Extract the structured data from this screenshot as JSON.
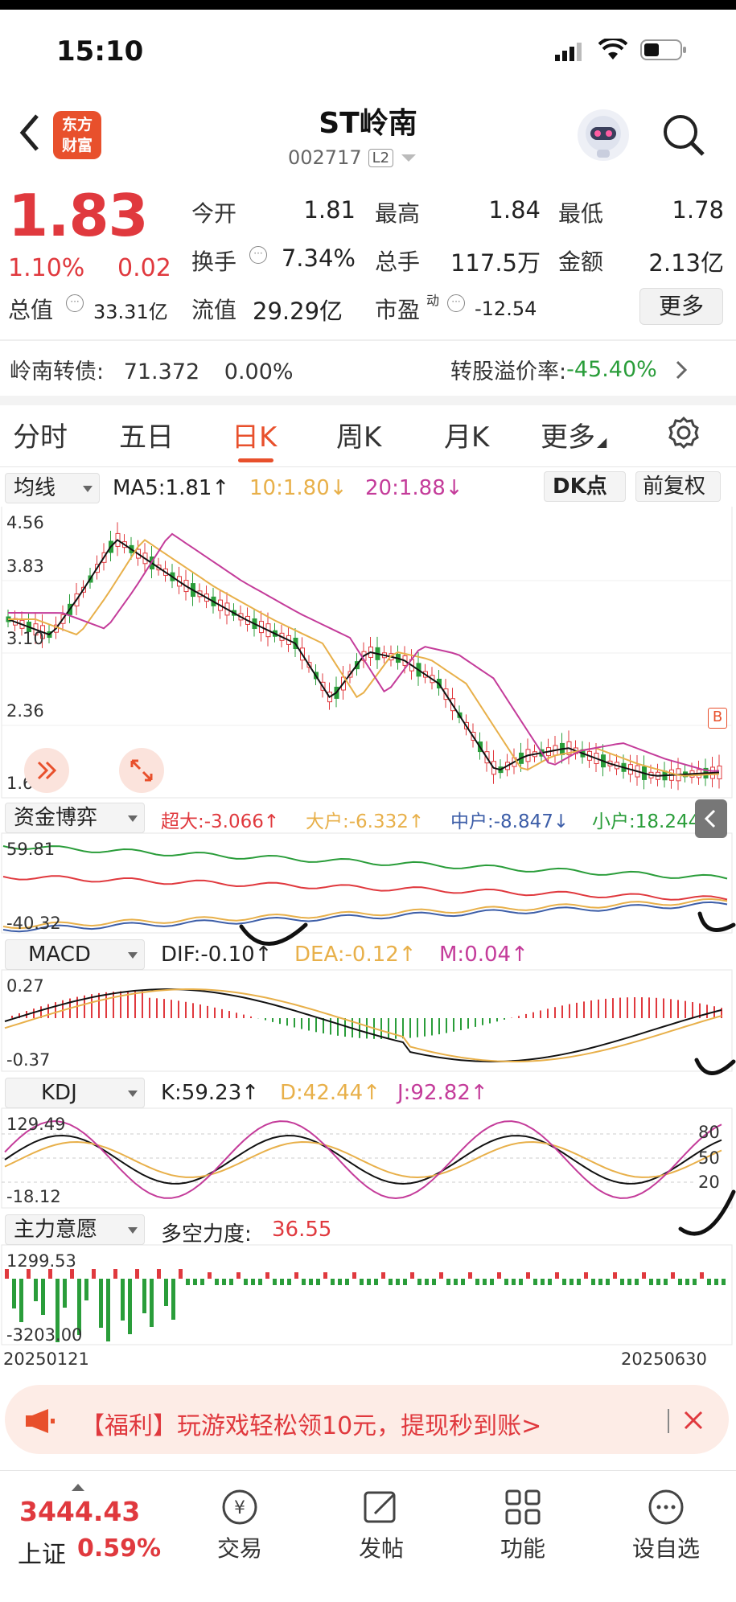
{
  "status": {
    "time": "15:10"
  },
  "header": {
    "back_label": "<",
    "logo_line1": "东方",
    "logo_line2": "财富",
    "title": "ST岭南",
    "code": "002717",
    "level_badge": "L2"
  },
  "quote": {
    "price": "1.83",
    "change_pct": "1.10%",
    "change_amt": "0.02",
    "open_label": "今开",
    "open": "1.81",
    "high_label": "最高",
    "high": "1.84",
    "low_label": "最低",
    "low": "1.78",
    "turnover_label": "换手",
    "turnover": "7.34%",
    "volume_label": "总手",
    "volume": "117.5万",
    "amount_label": "金额",
    "amount": "2.13亿",
    "mktcap_label": "总值",
    "mktcap": "33.31亿",
    "float_label": "流值",
    "float": "29.29亿",
    "pe_label": "市盈",
    "pe_sup": "动",
    "pe": "-12.54",
    "more_label": "更多"
  },
  "bond": {
    "label": "岭南转债:",
    "price": "71.372",
    "pct": "0.00%",
    "premium_label": "转股溢价率:",
    "premium": "-45.40%"
  },
  "tabs": [
    "分时",
    "五日",
    "日K",
    "周K",
    "月K",
    "更多"
  ],
  "active_tab": "日K",
  "kline": {
    "selector": "均线",
    "ma5": "MA5:1.81↑",
    "ma10": "10:1.80↓",
    "ma20": "20:1.88↓",
    "dk_label": "DK点",
    "adjust_label": "前复权",
    "y_labels": [
      "4.56",
      "3.83",
      "3.10",
      "2.36",
      "1.63"
    ],
    "b_marker": "B"
  },
  "fund": {
    "selector": "资金博弈",
    "super": "超大:-3.066↑",
    "large": "大户:-6.332↑",
    "mid": "中户:-8.847↓",
    "small": "小户:18.244↑",
    "y_top": "59.81",
    "y_bottom": "-40.32"
  },
  "macd": {
    "selector": "MACD",
    "dif": "DIF:-0.10↑",
    "dea": "DEA:-0.12↑",
    "m": "M:0.04↑",
    "y_top": "0.27",
    "y_bottom": "-0.37"
  },
  "kdj": {
    "selector": "KDJ",
    "k": "K:59.23↑",
    "d": "D:42.44↑",
    "j": "J:92.82↑",
    "y_top": "129.49",
    "y_bottom": "-18.12",
    "levels": [
      "80",
      "50",
      "20"
    ]
  },
  "main_force": {
    "selector": "主力意愿",
    "label": "多空力度:",
    "value": "36.55",
    "y_top": "1299.53",
    "y_bottom": "-3203.00"
  },
  "x_axis": {
    "start": "20250121",
    "end": "20250630"
  },
  "promo": {
    "text": "【福利】玩游戏轻松领10元，提现秒到账>"
  },
  "bottom": {
    "index_value": "3444.43",
    "index_name": "上证",
    "index_pct": "0.59%",
    "nav": [
      "交易",
      "发帖",
      "功能",
      "设自选"
    ]
  },
  "colors": {
    "up": "#e0393e",
    "down": "#2a9d3a",
    "ma5": "#111111",
    "ma10": "#e8b04a",
    "ma20": "#c43c9a",
    "accent": "#e8502c"
  }
}
